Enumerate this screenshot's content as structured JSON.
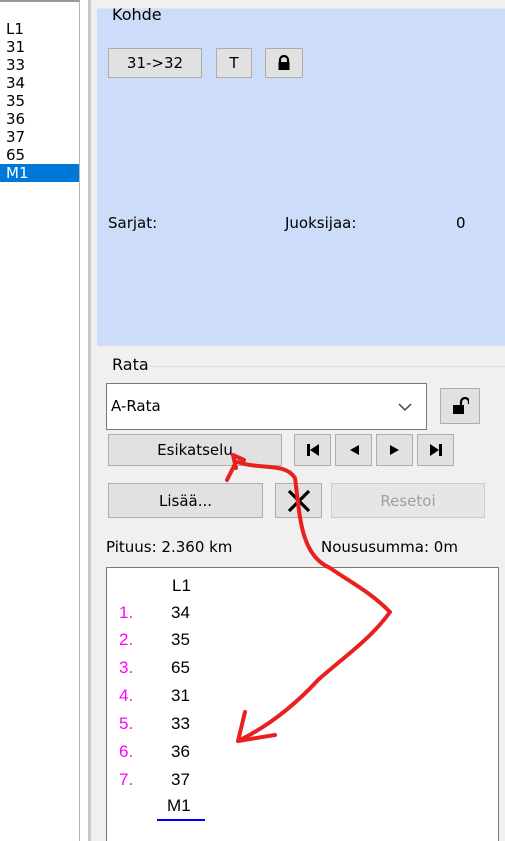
{
  "controls_list": {
    "items": [
      {
        "label": "L1",
        "selected": false
      },
      {
        "label": "31",
        "selected": false
      },
      {
        "label": "33",
        "selected": false
      },
      {
        "label": "34",
        "selected": false
      },
      {
        "label": "35",
        "selected": false
      },
      {
        "label": "36",
        "selected": false
      },
      {
        "label": "37",
        "selected": false
      },
      {
        "label": "65",
        "selected": false
      },
      {
        "label": "M1",
        "selected": true
      }
    ]
  },
  "kohde": {
    "title": "Kohde",
    "leg_button": "31->32",
    "t_button": "T",
    "lock_icon": "lock-closed-icon",
    "sarjat_label": "Sarjat:",
    "juoksijaa_label": "Juoksijaa:",
    "juoksijaa_value": "0"
  },
  "rata": {
    "title": "Rata",
    "selected_course": "A-Rata",
    "dropdown_icon": "chevron-down-icon",
    "unlock_icon": "lock-open-icon",
    "preview_button": "Esikatselu",
    "first_icon": "skip-first-icon",
    "prev_icon": "prev-icon",
    "next_icon": "next-icon",
    "last_icon": "skip-last-icon",
    "add_button": "Lisää...",
    "delete_icon": "delete-x-icon",
    "reset_button": "Resetoi",
    "length_text": "Pituus: 2.360 km",
    "climb_text": "Noususumma: 0m"
  },
  "course_controls": {
    "start": "L1",
    "rows": [
      {
        "num": "1.",
        "code": "34"
      },
      {
        "num": "2.",
        "code": "35"
      },
      {
        "num": "3.",
        "code": "65"
      },
      {
        "num": "4.",
        "code": "31"
      },
      {
        "num": "5.",
        "code": "33"
      },
      {
        "num": "6.",
        "code": "36"
      },
      {
        "num": "7.",
        "code": "37"
      }
    ],
    "finish": "M1"
  },
  "colors": {
    "selection": "#0078d7",
    "group_bg": "#cddcf8",
    "number_color": "#ff00ff",
    "annotation_red": "#e82020",
    "finish_underline": "#0000ff"
  }
}
